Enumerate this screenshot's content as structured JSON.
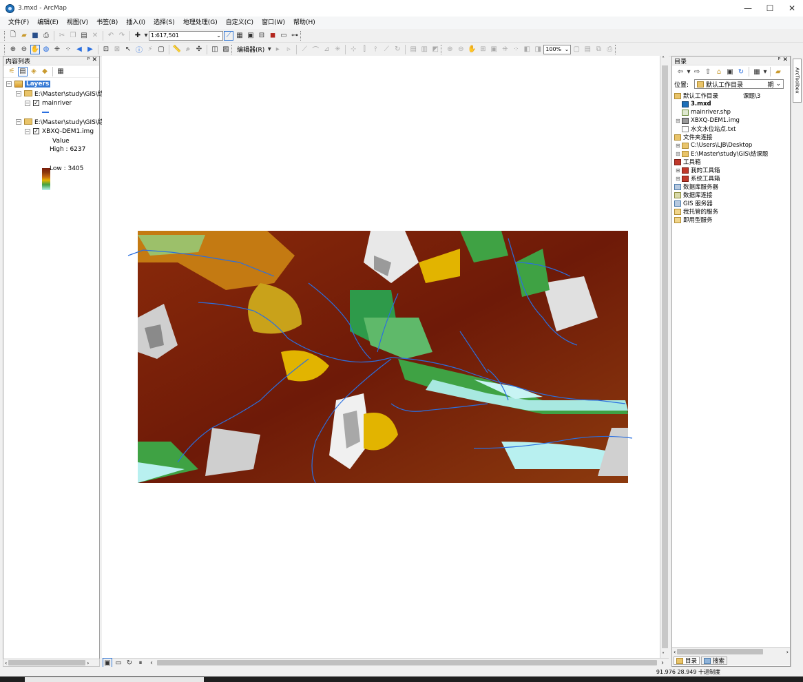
{
  "window": {
    "title": "3.mxd - ArcMap",
    "min": "—",
    "max": "☐",
    "close": "✕"
  },
  "menu": [
    "文件(F)",
    "编辑(E)",
    "视图(V)",
    "书签(B)",
    "插入(I)",
    "选择(S)",
    "地理处理(G)",
    "自定义(C)",
    "窗口(W)",
    "帮助(H)"
  ],
  "toolbar": {
    "scale": "1:617,501",
    "editor": "编辑器(R)",
    "zoom": "100%"
  },
  "toc": {
    "title": "内容列表",
    "pin": "ᵖ ✕",
    "root": "Layers",
    "group1": "E:\\Master\\study\\GIS\\结",
    "layer1": "mainriver",
    "group2": "E:\\Master\\study\\GIS\\结",
    "layer2": "XBXQ-DEM1.img",
    "legend_title": "Value",
    "high": "High : 6237",
    "low": "Low : 3405"
  },
  "catalog": {
    "title": "目录",
    "pin": "ᵖ ✕",
    "location_label": "位置:",
    "location_value": "默认工作目录",
    "location_tail": "期",
    "items": [
      {
        "label": "默认工作目录",
        "tail": "课题\\3",
        "indent": 0,
        "icon": "home-folder-icon",
        "exp": ""
      },
      {
        "label": "3.mxd",
        "indent": 1,
        "icon": "mxd-icon",
        "bold": true,
        "exp": ""
      },
      {
        "label": "mainriver.shp",
        "indent": 1,
        "icon": "shapefile-icon",
        "exp": ""
      },
      {
        "label": "XBXQ-DEM1.img",
        "indent": 1,
        "icon": "raster-icon",
        "exp": "⊞"
      },
      {
        "label": "水文水位站点.txt",
        "indent": 1,
        "icon": "text-file-icon",
        "exp": ""
      },
      {
        "label": "文件夹连接",
        "indent": 0,
        "icon": "folder-connections-icon",
        "exp": ""
      },
      {
        "label": "C:\\Users\\LJB\\Desktop",
        "indent": 1,
        "icon": "folder-icon",
        "exp": "⊞"
      },
      {
        "label": "E:\\Master\\study\\GIS\\结课题",
        "indent": 1,
        "icon": "folder-icon",
        "exp": "⊞"
      },
      {
        "label": "工具箱",
        "indent": 0,
        "icon": "toolbox-icon",
        "exp": ""
      },
      {
        "label": "我的工具箱",
        "indent": 1,
        "icon": "toolbox-icon",
        "exp": "⊞"
      },
      {
        "label": "系统工具箱",
        "indent": 1,
        "icon": "toolbox-icon",
        "exp": "⊞"
      },
      {
        "label": "数据库服务器",
        "indent": 0,
        "icon": "database-server-icon",
        "exp": ""
      },
      {
        "label": "数据库连接",
        "indent": 0,
        "icon": "database-connection-icon",
        "exp": ""
      },
      {
        "label": "GIS 服务器",
        "indent": 0,
        "icon": "gis-server-icon",
        "exp": ""
      },
      {
        "label": "我托管的服务",
        "indent": 0,
        "icon": "hosted-services-icon",
        "exp": ""
      },
      {
        "label": "即用型服务",
        "indent": 0,
        "icon": "ready-services-icon",
        "exp": ""
      }
    ],
    "tab_catalog": "目录",
    "tab_search": "搜索"
  },
  "arctoolbox": "ArcToolbox",
  "status": {
    "coords": "91.976  28.949 十进制度"
  },
  "colors": {
    "high": "#7a1d0a",
    "mid": "#e2b400",
    "low": "#b8f0f0",
    "river": "#2a6fe0"
  }
}
